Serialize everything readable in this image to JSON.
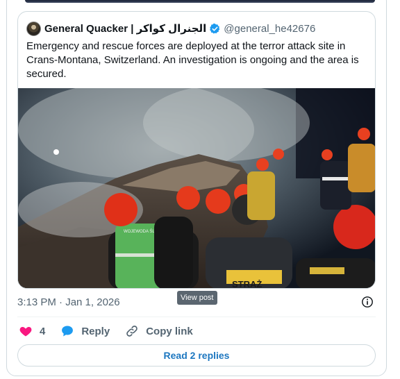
{
  "quoted_post": {
    "author_name": "General Quacker | الجنرال كواكر",
    "author_handle": "@general_he42676",
    "text": "Emergency and rescue forces are deployed at the terror attack site in Crans-Montana, Switzerland. An investigation is ongoing and the area is secured.",
    "image_signs": {
      "vest_text": "WOJEWODA ŚLĄSKI",
      "back_text": "STRAŻ"
    }
  },
  "post_meta": {
    "timestamp": "3:13 PM · Jan 1, 2026",
    "tooltip": "View post"
  },
  "actions": {
    "like_count": "4",
    "reply_label": "Reply",
    "copy_link_label": "Copy link"
  },
  "read_replies_label": "Read 2 replies",
  "colors": {
    "like": "#f91880",
    "reply": "#1d9bf0",
    "verified": "#1d9bf0",
    "link": "#1d77c0"
  },
  "icons": {
    "verified": "verified-badge-icon",
    "like": "heart-icon",
    "reply": "speech-bubble-icon",
    "copy": "link-icon",
    "info": "info-icon"
  }
}
